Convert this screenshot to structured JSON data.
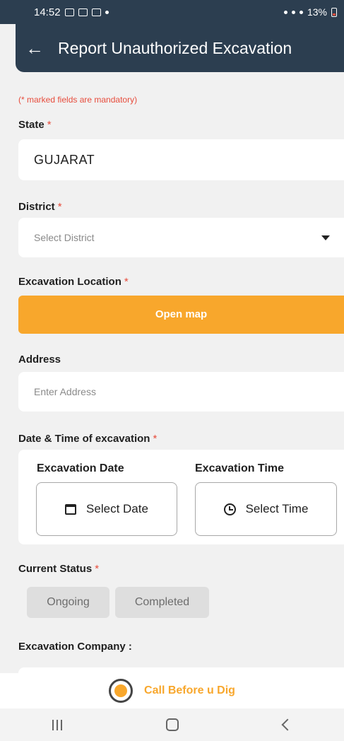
{
  "status_bar": {
    "time": "14:52",
    "battery": "13%"
  },
  "app_bar": {
    "back_icon": "arrow-left-icon",
    "title": "Report Unauthorized Excavation"
  },
  "form": {
    "mandatory_hint": "(* marked fields are mandatory)",
    "required_mark": "*",
    "state": {
      "label": "State",
      "value": "GUJARAT"
    },
    "district": {
      "label": "District",
      "placeholder": "Select District"
    },
    "location": {
      "label": "Excavation Location",
      "button": "Open map"
    },
    "address": {
      "label": "Address",
      "placeholder": "Enter Address"
    },
    "datetime": {
      "label": "Date & Time of excavation",
      "date_label": "Excavation Date",
      "date_button": "Select Date",
      "time_label": "Excavation Time",
      "time_button": "Select Time"
    },
    "status": {
      "label": "Current Status",
      "options": [
        "Ongoing",
        "Completed"
      ]
    },
    "company": {
      "label": "Excavation Company :"
    }
  },
  "footer": {
    "brand": "Call Before u Dig"
  },
  "colors": {
    "primary": "#2c3e50",
    "accent": "#f8a72c",
    "required": "#e74c3c",
    "background": "#f1f1f1"
  }
}
